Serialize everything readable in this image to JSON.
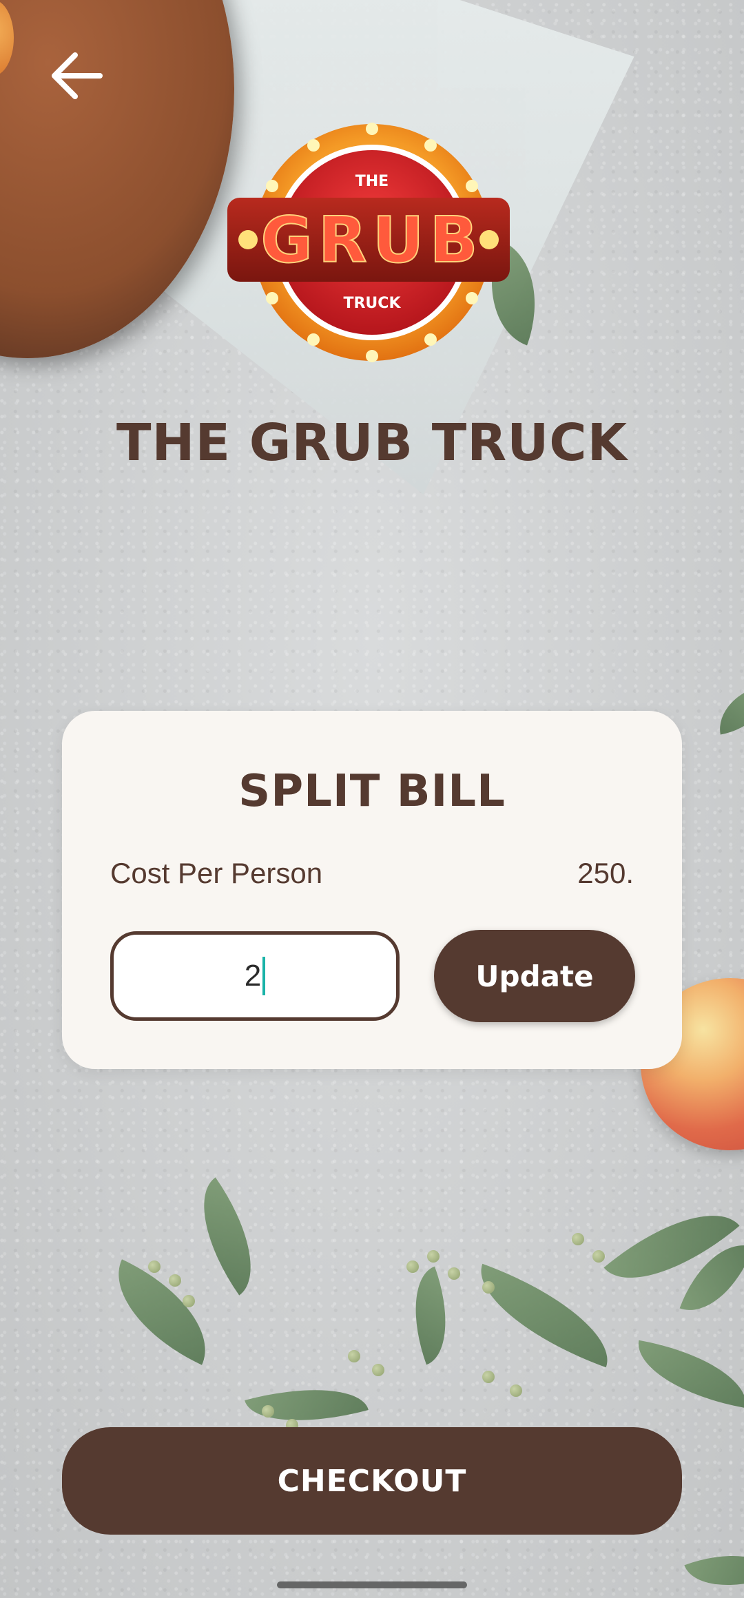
{
  "header": {
    "back_icon": "arrow-left-icon"
  },
  "logo": {
    "top_text": "THE",
    "main_text": "GRUB",
    "bottom_text": "TRUCK"
  },
  "brand_title": "THE GRUB TRUCK",
  "split_bill": {
    "title": "SPLIT BILL",
    "cost_label": "Cost Per Person",
    "cost_value": "250.",
    "people_count": "2",
    "update_label": "Update"
  },
  "checkout_label": "CHECKOUT",
  "colors": {
    "brand_brown": "#553a30",
    "card_bg": "#f9f6f2",
    "caret": "#1ab3a8"
  }
}
